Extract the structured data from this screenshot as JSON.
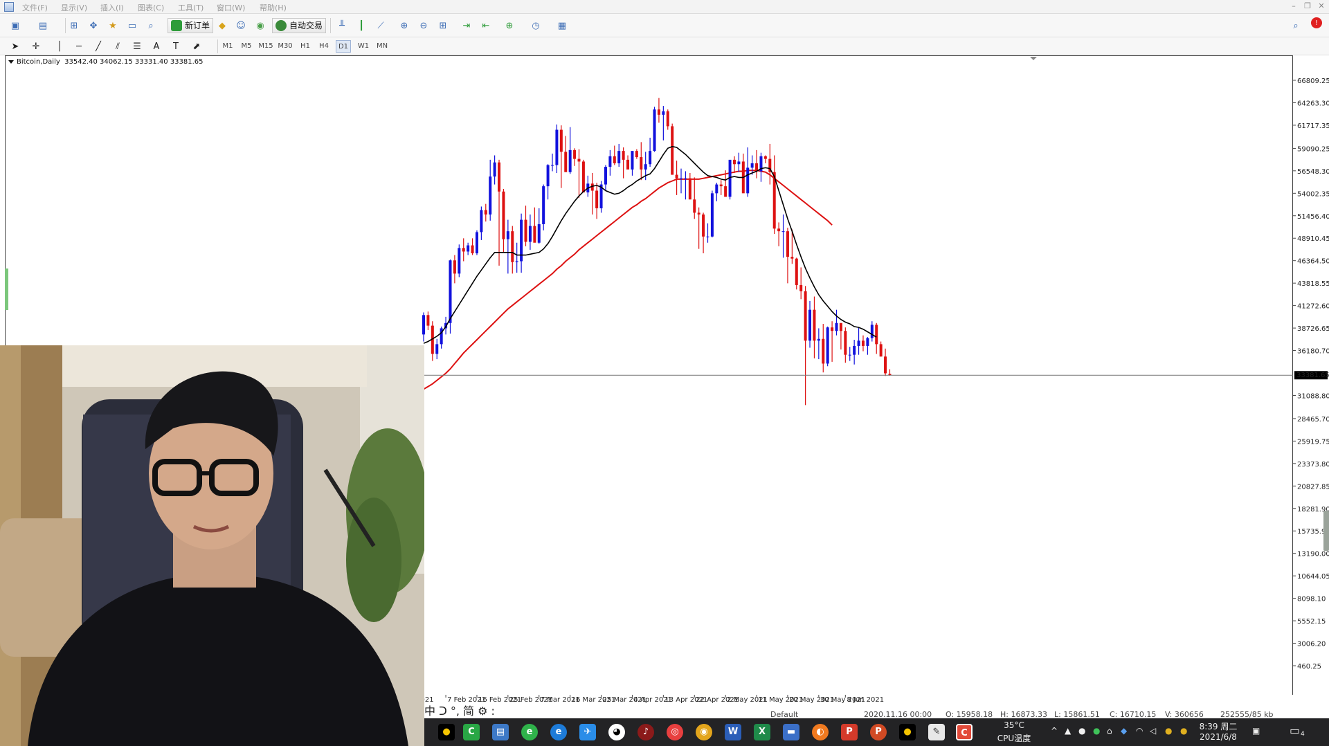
{
  "menu": {
    "items": [
      "文件(F)",
      "显示(V)",
      "插入(I)",
      "图表(C)",
      "工具(T)",
      "窗口(W)",
      "帮助(H)"
    ]
  },
  "toolbar": {
    "new_order_label": "新订单",
    "auto_trade_label": "自动交易",
    "timeframes": [
      "M1",
      "M5",
      "M15",
      "M30",
      "H1",
      "H4",
      "D1",
      "W1",
      "MN"
    ],
    "active_timeframe": "D1"
  },
  "chart_info": {
    "symbol": "Bitcoin,Daily",
    "ohlc": "33542.40 34062.15 33331.40 33381.65"
  },
  "current_price_label": "33381.65",
  "chart_data": {
    "type": "candlestick",
    "price_ticks": [
      "66809.25",
      "64263.30",
      "61717.35",
      "59090.25",
      "56548.30",
      "54002.35",
      "51456.40",
      "48910.45",
      "46364.50",
      "43818.55",
      "41272.60",
      "38726.65",
      "36180.70",
      "31088.80",
      "28465.70",
      "25919.75",
      "23373.80",
      "20827.85",
      "18281.90",
      "15735.95",
      "13190.00",
      "10644.05",
      "8098.10",
      "5552.15",
      "3006.20",
      "460.25"
    ],
    "date_ticks": [
      "2021",
      "7 Feb 2021",
      "16 Feb 2021",
      "25 Feb 2021",
      "7 Mar 2021",
      "16 Mar 2021",
      "25 Mar 2021",
      "4 Apr 2021",
      "13 Apr 2021",
      "22 Apr 2021",
      "2 May 2021",
      "11 May 2021",
      "20 May 2021",
      "30 May 2021",
      "8 Jun 2021"
    ],
    "current_price": 33381.65,
    "colors": {
      "bull": "#1111dd",
      "bear": "#dd1111",
      "ma_fast": "#000000",
      "ma_slow": "#dd1111"
    },
    "candles": [
      [
        38000,
        40500,
        37200,
        40200
      ],
      [
        40200,
        40600,
        38500,
        39000
      ],
      [
        39000,
        39500,
        35000,
        35800
      ],
      [
        35800,
        37500,
        35200,
        36900
      ],
      [
        36900,
        38900,
        36400,
        38700
      ],
      [
        38700,
        40000,
        38000,
        39300
      ],
      [
        39300,
        46500,
        38100,
        46400
      ],
      [
        46400,
        47000,
        43800,
        44900
      ],
      [
        44900,
        48200,
        44500,
        47800
      ],
      [
        47800,
        48900,
        46300,
        47400
      ],
      [
        47400,
        48400,
        47000,
        48100
      ],
      [
        48100,
        48900,
        47000,
        47200
      ],
      [
        47200,
        49800,
        47000,
        49600
      ],
      [
        49600,
        52500,
        48700,
        52100
      ],
      [
        52100,
        52800,
        50800,
        51600
      ],
      [
        51600,
        57800,
        50900,
        55900
      ],
      [
        55900,
        58300,
        55000,
        57500
      ],
      [
        57500,
        57800,
        45800,
        54200
      ],
      [
        54200,
        54500,
        47300,
        48800
      ],
      [
        48800,
        51000,
        44900,
        49700
      ],
      [
        49700,
        50300,
        44900,
        46200
      ],
      [
        46200,
        48400,
        45000,
        46300
      ],
      [
        46300,
        51700,
        45000,
        51000
      ],
      [
        51000,
        52600,
        48000,
        48500
      ],
      [
        48500,
        51600,
        47600,
        50300
      ],
      [
        50300,
        52400,
        49300,
        48400
      ],
      [
        48400,
        52300,
        48300,
        50500
      ],
      [
        50500,
        55000,
        49800,
        54800
      ],
      [
        54800,
        57300,
        53300,
        57200
      ],
      [
        57200,
        58500,
        56500,
        57200
      ],
      [
        57200,
        61800,
        56300,
        61200
      ],
      [
        61200,
        61700,
        54600,
        58700
      ],
      [
        58700,
        60500,
        56700,
        56400
      ],
      [
        56400,
        61500,
        56200,
        58900
      ],
      [
        58900,
        59100,
        57100,
        57900
      ],
      [
        57900,
        59000,
        53500,
        57600
      ],
      [
        57600,
        57800,
        54100,
        54100
      ],
      [
        54100,
        56000,
        53600,
        55100
      ],
      [
        55100,
        56300,
        51600,
        54300
      ],
      [
        54300,
        55200,
        51100,
        52300
      ],
      [
        52300,
        55400,
        51800,
        55000
      ],
      [
        55000,
        57200,
        54300,
        57000
      ],
      [
        57000,
        58900,
        56000,
        58200
      ],
      [
        58200,
        59400,
        57200,
        57400
      ],
      [
        57400,
        59600,
        57000,
        58800
      ],
      [
        58800,
        59200,
        55700,
        57800
      ],
      [
        57800,
        58300,
        57000,
        56700
      ],
      [
        56700,
        58500,
        56000,
        58800
      ],
      [
        58800,
        59000,
        57900,
        58100
      ],
      [
        58100,
        59800,
        55500,
        56700
      ],
      [
        56700,
        58700,
        55500,
        57300
      ],
      [
        57300,
        60300,
        57000,
        58800
      ],
      [
        58800,
        63800,
        58700,
        63500
      ],
      [
        63500,
        64800,
        62000,
        62900
      ],
      [
        62900,
        63900,
        60000,
        63300
      ],
      [
        63300,
        63500,
        61200,
        61600
      ],
      [
        61600,
        61900,
        56100,
        56100
      ],
      [
        56100,
        57700,
        53800,
        55700
      ],
      [
        55700,
        56800,
        54000,
        55700
      ],
      [
        55700,
        56500,
        53300,
        55700
      ],
      [
        55700,
        56300,
        54100,
        53300
      ],
      [
        53300,
        55800,
        51100,
        51800
      ],
      [
        51800,
        52400,
        47700,
        51600
      ],
      [
        51600,
        51800,
        47200,
        49100
      ],
      [
        49100,
        50600,
        48400,
        49100
      ],
      [
        49100,
        54300,
        49000,
        54000
      ],
      [
        54000,
        55200,
        53100,
        55000
      ],
      [
        55000,
        55500,
        53800,
        54800
      ],
      [
        54800,
        56600,
        53600,
        53600
      ],
      [
        53600,
        57600,
        53300,
        57800
      ],
      [
        57800,
        58200,
        56300,
        57300
      ],
      [
        57300,
        58600,
        56400,
        57600
      ],
      [
        57600,
        58500,
        54700,
        54000
      ],
      [
        54000,
        59200,
        53600,
        56900
      ],
      [
        56900,
        58300,
        56100,
        57400
      ],
      [
        57400,
        58900,
        55700,
        56500
      ],
      [
        56500,
        58600,
        55300,
        58200
      ],
      [
        58200,
        58300,
        57400,
        57900
      ],
      [
        57900,
        59600,
        55000,
        56400
      ],
      [
        56400,
        58300,
        49400,
        50000
      ],
      [
        50000,
        50700,
        48000,
        49700
      ],
      [
        49700,
        51600,
        46700,
        49700
      ],
      [
        49700,
        50100,
        43800,
        46800
      ],
      [
        46800,
        49900,
        46000,
        46600
      ],
      [
        46600,
        46700,
        43100,
        43600
      ],
      [
        43600,
        45600,
        42000,
        42900
      ],
      [
        42900,
        43500,
        30000,
        37300
      ],
      [
        37300,
        41800,
        36500,
        40800
      ],
      [
        40800,
        42300,
        35300,
        37300
      ],
      [
        37300,
        38700,
        35200,
        37500
      ],
      [
        37500,
        39200,
        33700,
        34700
      ],
      [
        34700,
        38900,
        34400,
        38800
      ],
      [
        38800,
        39500,
        34900,
        38400
      ],
      [
        38400,
        40800,
        37900,
        39300
      ],
      [
        39300,
        39300,
        36300,
        38400
      ],
      [
        38400,
        38800,
        34800,
        35700
      ],
      [
        35700,
        36600,
        35000,
        35700
      ],
      [
        35700,
        37400,
        34600,
        36700
      ],
      [
        36700,
        38800,
        35700,
        37300
      ],
      [
        37300,
        37900,
        36100,
        36700
      ],
      [
        36700,
        37700,
        35700,
        37600
      ],
      [
        37600,
        39500,
        37200,
        39100
      ],
      [
        39100,
        39300,
        35800,
        36900
      ],
      [
        36900,
        37200,
        35500,
        35500
      ],
      [
        35500,
        36400,
        33300,
        33600
      ],
      [
        33542,
        34062,
        33331,
        33382
      ]
    ],
    "ma_fast": [
      [
        37000,
        37200,
        37500,
        37800,
        38200,
        38900,
        39800,
        40600,
        41400,
        42200,
        43000,
        43800,
        44600,
        45300,
        46000,
        46700,
        47300,
        47300,
        47300,
        47300,
        47300,
        47000,
        47000,
        47000,
        47100,
        47200,
        47300,
        47700,
        48300,
        49100,
        50000,
        50900,
        51700,
        52400,
        53100,
        53700,
        54200,
        54600,
        54800,
        54900,
        54700,
        54300,
        54100,
        53900,
        54000,
        54300,
        54700,
        55000,
        55400,
        55700,
        56000,
        56200,
        56800,
        57600,
        58400,
        59100,
        59300,
        59200,
        58800,
        58400,
        57900,
        57400,
        56900,
        56400,
        56000,
        55900,
        55800,
        55600,
        55500,
        55800,
        55900,
        55800,
        55800,
        56100,
        56300,
        56500,
        56800,
        56900,
        56800,
        55900,
        54300,
        52700,
        51100,
        49700,
        48200,
        46800,
        45500,
        44400,
        43400,
        42500,
        41800,
        41200,
        40600,
        40100,
        39700,
        39400,
        39200,
        38900,
        38800,
        38600,
        38300,
        38000,
        37700
      ]
    ],
    "ma_slow": [
      [
        31800,
        32100,
        32400,
        32800,
        33200,
        33600,
        34100,
        34700,
        35300,
        35900,
        36400,
        36900,
        37400,
        37900,
        38400,
        38900,
        39400,
        39900,
        40400,
        40900,
        41300,
        41700,
        42100,
        42500,
        42900,
        43300,
        43700,
        44100,
        44500,
        44900,
        45400,
        45800,
        46300,
        46700,
        47100,
        47600,
        48000,
        48400,
        48800,
        49200,
        49600,
        50000,
        50400,
        50800,
        51200,
        51600,
        52000,
        52400,
        52700,
        53100,
        53400,
        53800,
        54200,
        54600,
        54900,
        55200,
        55400,
        55600,
        55600,
        55600,
        55600,
        55600,
        55600,
        55700,
        55800,
        55900,
        56000,
        56100,
        56200,
        56300,
        56400,
        56500,
        56500,
        56600,
        56600,
        56600,
        56500,
        56400,
        56100,
        55700,
        55300,
        54900,
        54500,
        54100,
        53700,
        53300,
        52900,
        52500,
        52100,
        51700,
        51300,
        50900,
        50400
      ]
    ]
  },
  "ime": "中 ᑐ °, 简 ⚙ :",
  "status": {
    "profile": "Default",
    "datetime": "2020.11.16 00:00",
    "open": "O: 15958.18",
    "high": "H: 16873.33",
    "low": "L: 15861.51",
    "close": "C: 16710.15",
    "volume": "V: 360656",
    "traffic": "252555/85 kb"
  },
  "tray": {
    "temperature": "35°C",
    "cpu_label": "CPU温度",
    "time": "8:39 周二",
    "date": "2021/6/8",
    "notification_count": "4"
  }
}
